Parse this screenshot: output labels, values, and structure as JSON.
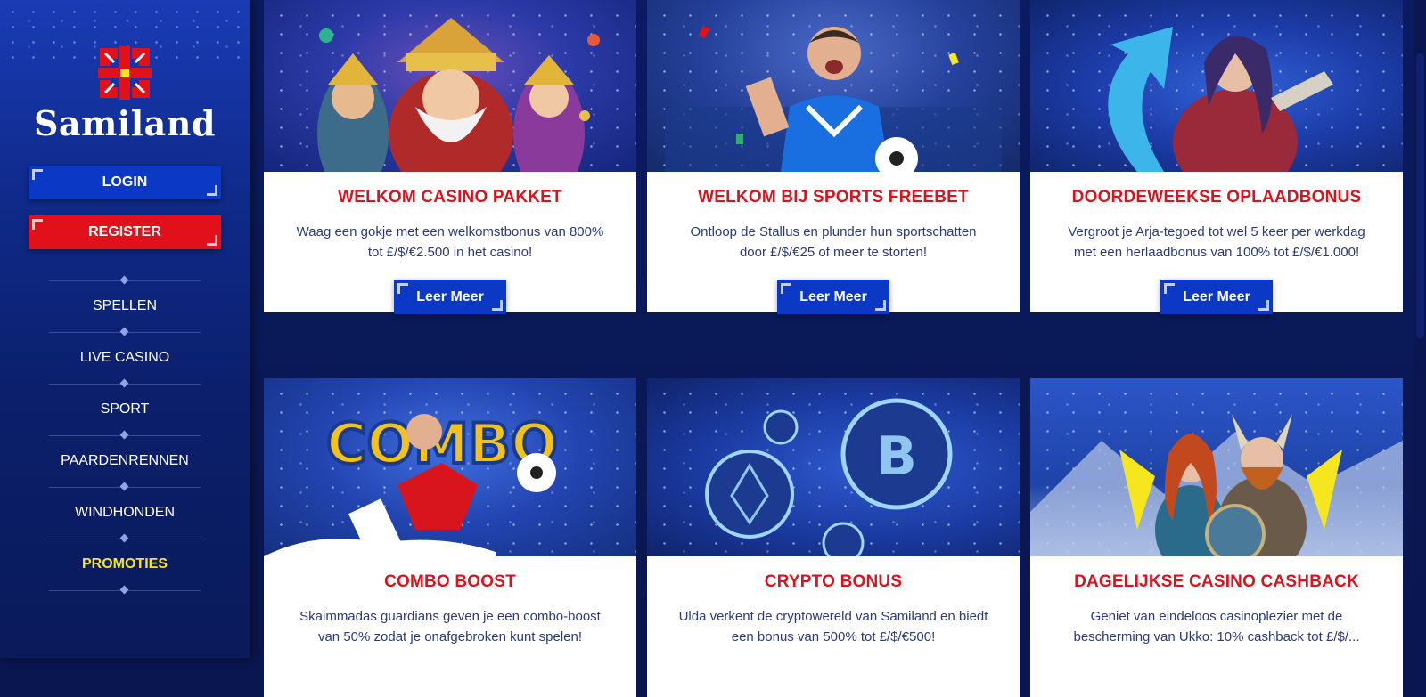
{
  "brand": {
    "name": "Samiland"
  },
  "auth": {
    "login_label": "LOGIN",
    "register_label": "REGISTER"
  },
  "nav": {
    "items": [
      {
        "label": "SPELLEN",
        "active": false
      },
      {
        "label": "LIVE CASINO",
        "active": false
      },
      {
        "label": "SPORT",
        "active": false
      },
      {
        "label": "PAARDENRENNEN",
        "active": false
      },
      {
        "label": "WINDHONDEN",
        "active": false
      },
      {
        "label": "PROMOTIES",
        "active": true
      }
    ]
  },
  "promotions": [
    {
      "title": "WELKOM CASINO PAKKET",
      "description": "Waag een gokje met een welkomstbonus van 800% tot £/$/€2.500 in het casino!",
      "button": "Leer Meer",
      "image": "norse-gods-illustration"
    },
    {
      "title": "WELKOM BIJ SPORTS FREEBET",
      "description": "Ontloop de Stallus en plunder hun sportschatten door £/$/€25 of meer te storten!",
      "button": "Leer Meer",
      "image": "football-player-illustration"
    },
    {
      "title": "DOORDEWEEKSE OPLAADBONUS",
      "description": "Vergroot je Arja-tegoed tot wel 5 keer per werkdag met een herlaadbonus van 100% tot £/$/€1.000!",
      "button": "Leer Meer",
      "image": "warrior-woman-illustration"
    },
    {
      "title": "COMBO BOOST",
      "description": "Skaimmadas guardians geven je een combo-boost van 50% zodat je onafgebroken kunt spelen!",
      "image": "combo-football-illustration"
    },
    {
      "title": "CRYPTO BONUS",
      "description": "Ulda verkent de cryptowereld van Samiland en biedt een bonus van 500% tot £/$/€500!",
      "image": "crypto-coins-illustration"
    },
    {
      "title": "DAGELIJKSE CASINO CASHBACK",
      "description": "Geniet van eindeloos casinoplezier met de bescherming van Ukko: 10% cashback tot £/$/...",
      "image": "viking-couple-illustration"
    }
  ],
  "colors": {
    "sidebar": "#0f2a8a",
    "primary_button": "#0b38c5",
    "register_button": "#e2101b",
    "active_nav": "#f6e61f",
    "card_title": "#d8141d"
  }
}
